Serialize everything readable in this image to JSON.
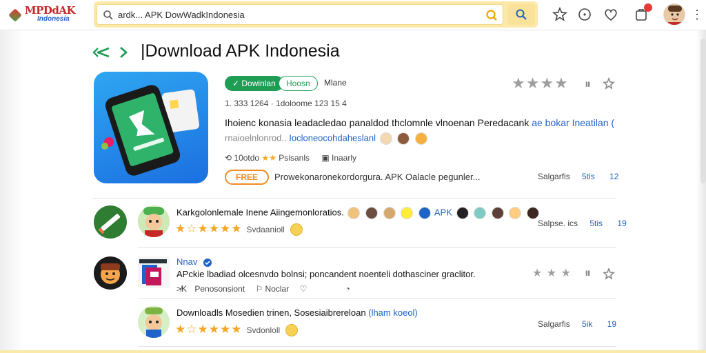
{
  "logo": {
    "text": "MPDdAK",
    "sub": "Indonesia"
  },
  "search": {
    "query": "ardk... APK DowWadkIndonesia"
  },
  "breadcrumb": {
    "title": "|Download APK Indonesia"
  },
  "featured": {
    "tag_primary": "✓ Dowinlan",
    "tag_secondary": "Hoosn",
    "meta_label": "Mlane",
    "stats": "1. 333 1264   · 1doloome 123 15 4",
    "desc_line1": "Ihoienc konasia leadacledao panaldod thclomnle vlnoenan Peredacank",
    "desc_line1_link": "ae bokar Ineatilan (",
    "desc_line2": "rnaioelnlonrod..",
    "desc_line2_link": "Iocloneocohdaheslanl",
    "rating_text": "10otdo",
    "rating_label": "Psisanls",
    "secondary_label": "Inaarly",
    "free_button": "FREE",
    "free_desc": "Prowekonaronekordorgura. APK Oalacle pegunler...",
    "right_a": "Salgarfis",
    "right_b": "5tis",
    "right_c": "12"
  },
  "rows": [
    {
      "title": "Karkgolonlemale Inene Aiingemonloratios.",
      "title_link": "APK",
      "stars_label": "Svdaanioll",
      "right_a": "Salpse. ics",
      "right_b": "5tis",
      "right_c": "19"
    },
    {
      "title": "Nnav",
      "desc": "APckie lbadiad olcesnvdo bolnsi; poncandent noenteli dothasciner graclitor.",
      "stat1": "Penosonsiont",
      "stat2": "Noclar",
      "stat_prefix": "≯K"
    },
    {
      "title": "Downloadls Mosedien trinen, Sosesiaibrereloan",
      "title_link": "(lham koeol)",
      "stars_label": "Svdonloll",
      "right_a": "Salgarfis",
      "right_b": "5ik",
      "right_c": "19"
    }
  ],
  "colors": {
    "accent": "#1f9d55",
    "link": "#1e63c7",
    "star": "#f5a623",
    "free": "#f08a24",
    "search_bg": "#fbe9a9"
  }
}
